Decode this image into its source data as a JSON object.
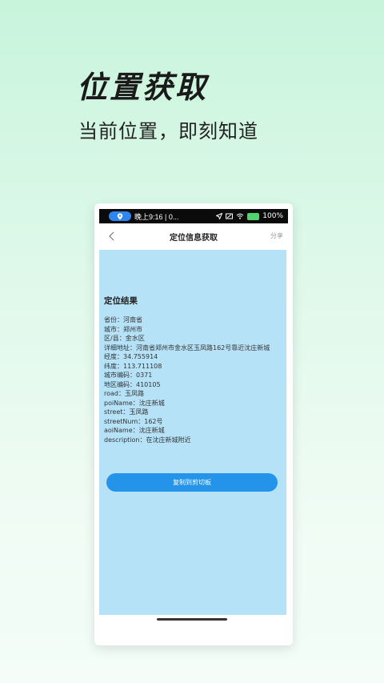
{
  "promo": {
    "title": "位置获取",
    "subtitle": "当前位置，即刻知道"
  },
  "statusbar": {
    "time": "晚上9:16 | 0...",
    "battery": "100%"
  },
  "navbar": {
    "title": "定位信息获取",
    "share_label": "分享"
  },
  "result": {
    "title": "定位结果",
    "lines": [
      "省份：河南省",
      "城市：郑州市",
      "区/县：金水区",
      "详细地址：河南省郑州市金水区玉凤路162号靠近沈庄新城",
      "经度：34.755914",
      "纬度：113.711108",
      "城市编码：0371",
      "地区编码：410105",
      "road：玉凤路",
      "poiName：沈庄新城",
      "street：玉凤路",
      "streetNum：162号",
      "aoiName：沈庄新城",
      "description：在沈庄新城附近"
    ]
  },
  "copy_button_label": "复制到剪切板",
  "colors": {
    "accent": "#2493ea",
    "content_bg": "#b6e2f8",
    "page_bg_top": "#c8f4dc"
  }
}
